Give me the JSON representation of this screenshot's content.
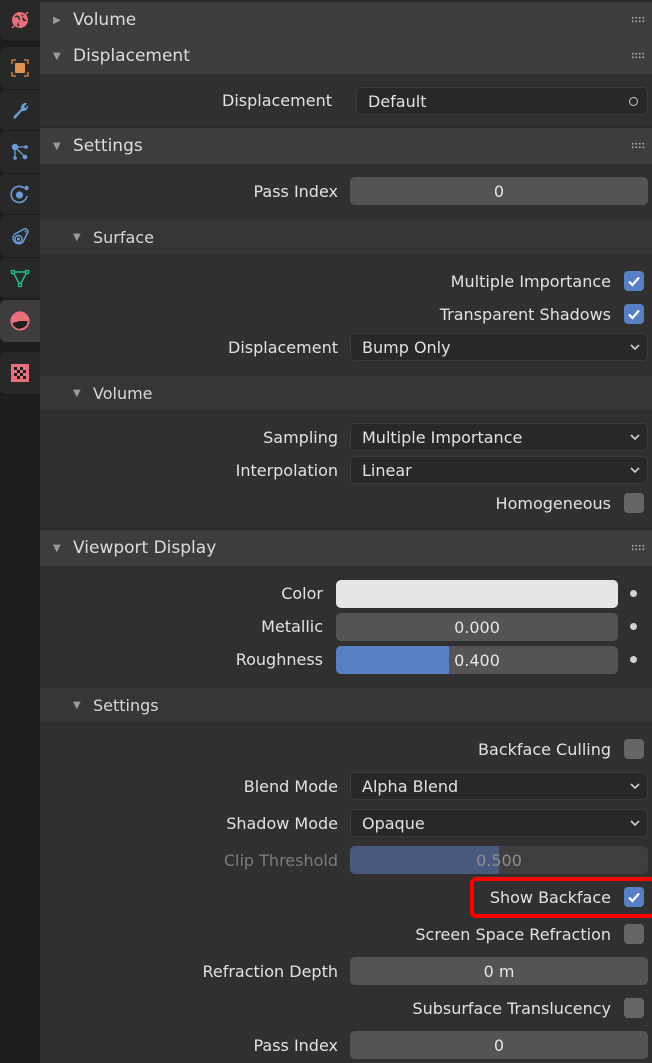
{
  "sidebar": {
    "tabs": [
      {
        "name": "world-tab",
        "icon": "world-icon",
        "color": "#e5707a"
      },
      {
        "name": "object-tab",
        "icon": "object-icon",
        "color": "#e0924f"
      },
      {
        "name": "modifier-tab",
        "icon": "wrench-icon",
        "color": "#6a9bd8"
      },
      {
        "name": "particles-tab",
        "icon": "particles-icon",
        "color": "#6a9bd8"
      },
      {
        "name": "physics-tab",
        "icon": "physics-icon",
        "color": "#6a9bd8"
      },
      {
        "name": "constraints-tab",
        "icon": "constraints-icon",
        "color": "#6a9bd8"
      },
      {
        "name": "data-tab",
        "icon": "mesh-data-icon",
        "color": "#1fbf8a"
      },
      {
        "name": "material-tab",
        "icon": "material-icon",
        "color": "#e5707a",
        "active": true
      },
      {
        "name": "texture-tab",
        "icon": "texture-icon",
        "color": "#e5707a"
      }
    ]
  },
  "panels": {
    "volume": {
      "title": "Volume",
      "collapsed": true
    },
    "displacement": {
      "title": "Displacement",
      "field_label": "Displacement",
      "field_value": "Default"
    },
    "settings": {
      "title": "Settings",
      "pass_index_label": "Pass Index",
      "pass_index_value": "0",
      "surface": {
        "title": "Surface",
        "multiple_importance_label": "Multiple Importance",
        "multiple_importance_checked": true,
        "transparent_shadows_label": "Transparent Shadows",
        "transparent_shadows_checked": true,
        "displacement_label": "Displacement",
        "displacement_value": "Bump Only"
      },
      "volume": {
        "title": "Volume",
        "sampling_label": "Sampling",
        "sampling_value": "Multiple Importance",
        "interpolation_label": "Interpolation",
        "interpolation_value": "Linear",
        "homogeneous_label": "Homogeneous",
        "homogeneous_checked": false
      }
    },
    "viewport_display": {
      "title": "Viewport Display",
      "color_label": "Color",
      "color_value": "#e6e6e6",
      "metallic_label": "Metallic",
      "metallic_value": "0.000",
      "metallic_fraction": 0.0,
      "roughness_label": "Roughness",
      "roughness_value": "0.400",
      "roughness_fraction": 0.4,
      "settings": {
        "title": "Settings",
        "backface_culling_label": "Backface Culling",
        "backface_culling_checked": false,
        "blend_mode_label": "Blend Mode",
        "blend_mode_value": "Alpha Blend",
        "shadow_mode_label": "Shadow Mode",
        "shadow_mode_value": "Opaque",
        "clip_threshold_label": "Clip Threshold",
        "clip_threshold_value": "0.500",
        "clip_threshold_fraction": 0.5,
        "show_backface_label": "Show Backface",
        "show_backface_checked": true,
        "ssr_label": "Screen Space Refraction",
        "ssr_checked": false,
        "refraction_depth_label": "Refraction Depth",
        "refraction_depth_value": "0 m",
        "subsurface_label": "Subsurface Translucency",
        "subsurface_checked": false,
        "pass_index_label": "Pass Index",
        "pass_index_value": "0"
      }
    }
  },
  "colors": {
    "accent": "#5680c2",
    "highlight": "#ff0000"
  }
}
